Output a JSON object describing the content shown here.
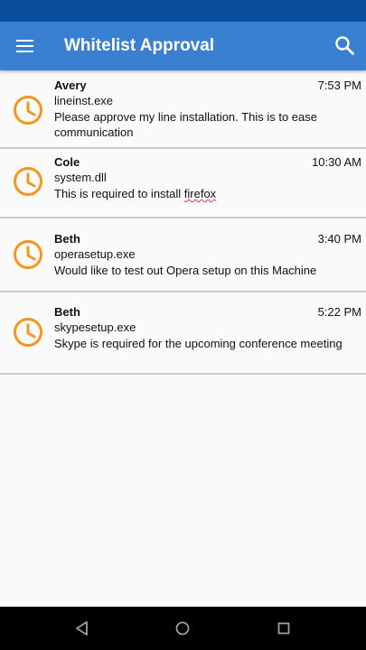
{
  "app_bar": {
    "title": "Whitelist Approval",
    "menu_icon": "menu-icon",
    "search_icon": "search-icon",
    "color": "#3a80d1"
  },
  "status_bar": {
    "color": "#0b4f9c"
  },
  "accent_color": "#f7941d",
  "requests": [
    {
      "sender": "Avery",
      "time": "7:53 PM",
      "file": "lineinst.exe",
      "message": "Please approve my line installation. This is to ease communication",
      "icon": "clock-icon"
    },
    {
      "sender": "Cole",
      "time": "10:30 AM",
      "file": "system.dll",
      "message_prefix": "This is required to install ",
      "message_flagged_word": "firefox",
      "icon": "clock-icon"
    },
    {
      "sender": "Beth",
      "time": "3:40 PM",
      "file": "operasetup.exe",
      "message": "Would like to test out Opera setup on this Machine",
      "icon": "clock-icon"
    },
    {
      "sender": "Beth",
      "time": "5:22 PM",
      "file": "skypesetup.exe",
      "message": "Skype is required for the upcoming conference meeting",
      "icon": "clock-icon"
    }
  ],
  "nav_bar": {
    "back_icon": "back-icon",
    "home_icon": "home-icon",
    "recents_icon": "recents-icon"
  }
}
